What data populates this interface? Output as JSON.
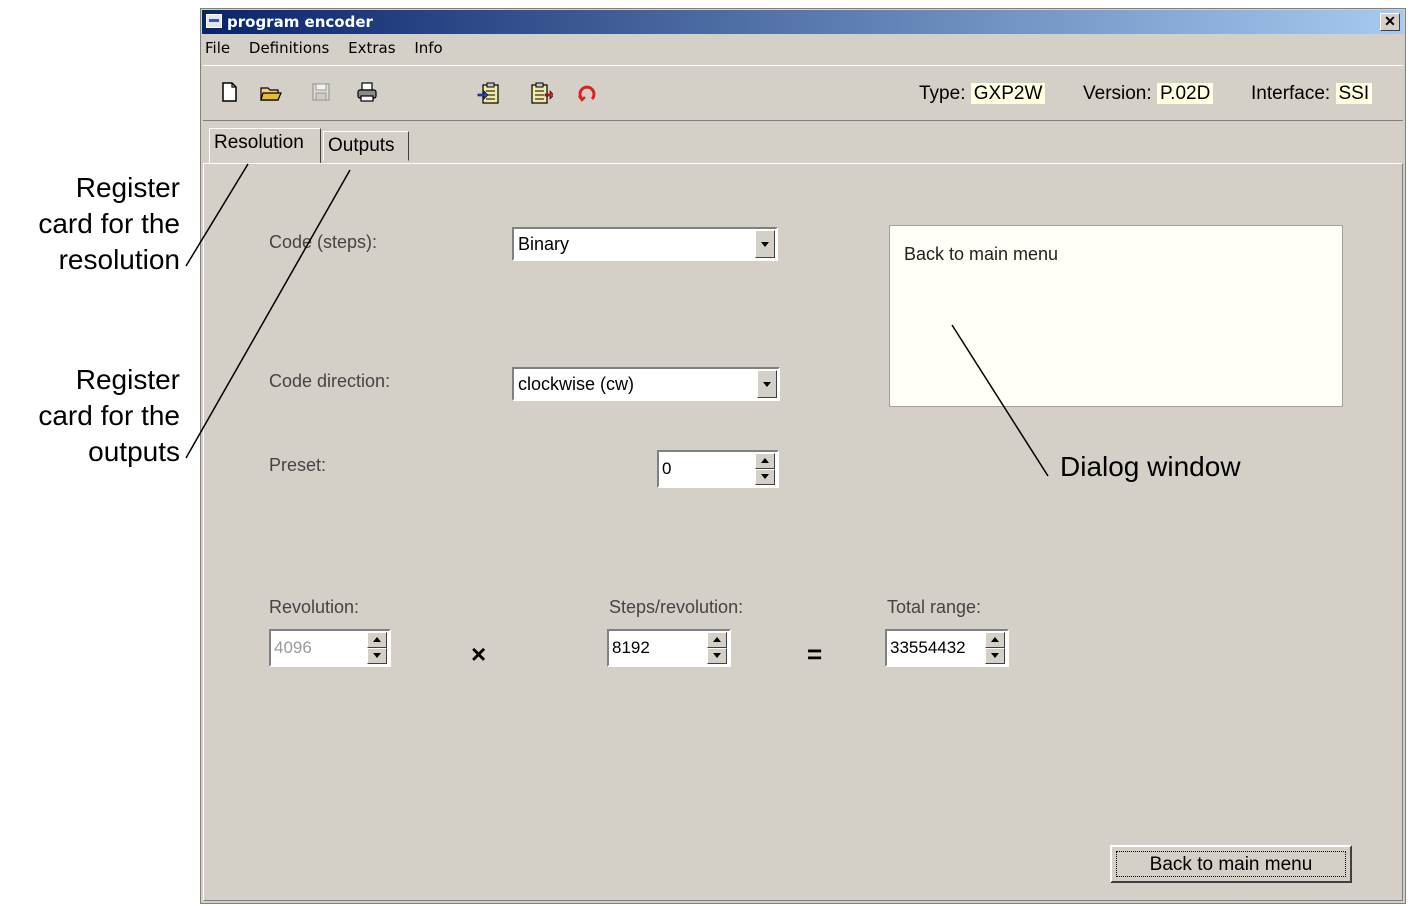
{
  "annotations": {
    "resolution_card": [
      "Register",
      "card for the",
      "resolution"
    ],
    "outputs_card": [
      "Register",
      "card for the",
      "outputs"
    ],
    "dialog_window": "Dialog window"
  },
  "window": {
    "title": "program encoder",
    "close_label": "✕"
  },
  "menu": {
    "file": "File",
    "definitions": "Definitions",
    "extras": "Extras",
    "info": "Info"
  },
  "toolbar": {
    "type_label": "Type:",
    "type_value": "GXP2W",
    "version_label": "Version:",
    "version_value": "P.02D",
    "interface_label": "Interface:",
    "interface_value": "SSI",
    "icons": [
      "new-file-icon",
      "open-folder-icon",
      "save-icon",
      "print-icon",
      "read-device-icon",
      "write-device-icon",
      "refresh-icon"
    ]
  },
  "tabs": {
    "resolution": "Resolution",
    "outputs": "Outputs"
  },
  "form": {
    "code_steps_label": "Code (steps):",
    "code_steps_value": "Binary",
    "code_direction_label": "Code direction:",
    "code_direction_value": "clockwise (cw)",
    "preset_label": "Preset:",
    "preset_value": "0",
    "revolution_label": "Revolution:",
    "revolution_value": "4096",
    "steps_label": "Steps/revolution:",
    "steps_value": "8192",
    "total_label": "Total range:",
    "total_value": "33554432",
    "times_symbol": "×",
    "equals_symbol": "="
  },
  "dialog": {
    "text": "Back to main menu"
  },
  "buttons": {
    "back": "Back to main menu"
  }
}
